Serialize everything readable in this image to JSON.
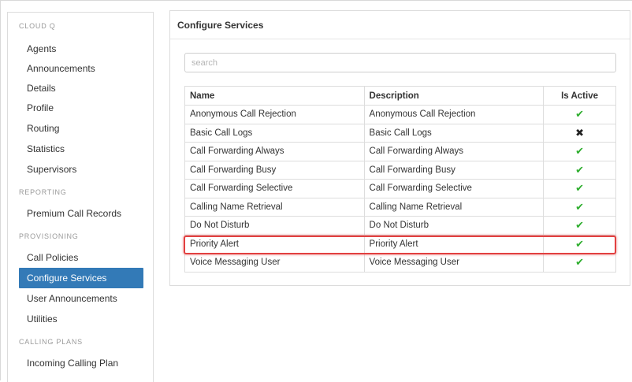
{
  "sidebar": {
    "sections": [
      {
        "header": "CLOUD Q",
        "items": [
          "Agents",
          "Announcements",
          "Details",
          "Profile",
          "Routing",
          "Statistics",
          "Supervisors"
        ]
      },
      {
        "header": "REPORTING",
        "items": [
          "Premium Call Records"
        ]
      },
      {
        "header": "PROVISIONING",
        "items": [
          "Call Policies",
          "Configure Services",
          "User Announcements",
          "Utilities"
        ]
      },
      {
        "header": "CALLING PLANS",
        "items": [
          "Incoming Calling Plan"
        ]
      }
    ],
    "active_item": "Configure Services"
  },
  "panel": {
    "title": "Configure Services",
    "search_placeholder": "search",
    "columns": [
      "Name",
      "Description",
      "Is Active"
    ],
    "rows": [
      {
        "name": "Anonymous Call Rejection",
        "description": "Anonymous Call Rejection",
        "active": true,
        "active_icon": "check-icon"
      },
      {
        "name": "Basic Call Logs",
        "description": "Basic Call Logs",
        "active": false,
        "active_icon": "x-icon"
      },
      {
        "name": "Call Forwarding Always",
        "description": "Call Forwarding Always",
        "active": true,
        "active_icon": "check-icon"
      },
      {
        "name": "Call Forwarding Busy",
        "description": "Call Forwarding Busy",
        "active": true,
        "active_icon": "check-icon"
      },
      {
        "name": "Call Forwarding Selective",
        "description": "Call Forwarding Selective",
        "active": true,
        "active_icon": "check-icon"
      },
      {
        "name": "Calling Name Retrieval",
        "description": "Calling Name Retrieval",
        "active": true,
        "active_icon": "check-icon"
      },
      {
        "name": "Do Not Disturb",
        "description": "Do Not Disturb",
        "active": true,
        "active_icon": "check-icon"
      },
      {
        "name": "Priority Alert",
        "description": "Priority Alert",
        "active": true,
        "active_icon": "check-icon"
      },
      {
        "name": "Voice Messaging User",
        "description": "Voice Messaging User",
        "active": true,
        "active_icon": "check-icon"
      }
    ],
    "highlighted_row": "Priority Alert"
  },
  "colors": {
    "accent": "#337ab7",
    "check": "#2eae2e",
    "highlight": "#e24040"
  }
}
